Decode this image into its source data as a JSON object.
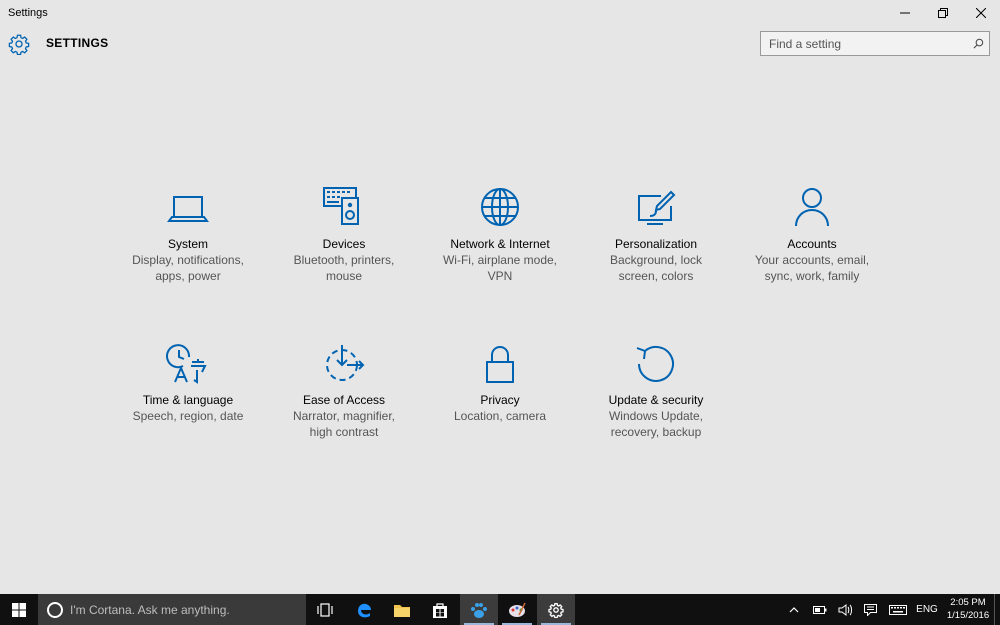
{
  "window": {
    "title": "Settings"
  },
  "header": {
    "app_title": "SETTINGS",
    "search_placeholder": "Find a setting"
  },
  "categories": [
    {
      "name": "System",
      "desc1": "Display, notifications,",
      "desc2": "apps, power",
      "icon": "laptop-icon"
    },
    {
      "name": "Devices",
      "desc1": "Bluetooth, printers,",
      "desc2": "mouse",
      "icon": "devices-icon"
    },
    {
      "name": "Network & Internet",
      "desc1": "Wi-Fi, airplane mode,",
      "desc2": "VPN",
      "icon": "globe-icon"
    },
    {
      "name": "Personalization",
      "desc1": "Background, lock",
      "desc2": "screen, colors",
      "icon": "paint-icon"
    },
    {
      "name": "Accounts",
      "desc1": "Your accounts, email,",
      "desc2": "sync, work, family",
      "icon": "person-icon"
    },
    {
      "name": "Time & language",
      "desc1": "Speech, region, date",
      "desc2": "",
      "icon": "time-language-icon"
    },
    {
      "name": "Ease of Access",
      "desc1": "Narrator, magnifier,",
      "desc2": "high contrast",
      "icon": "ease-of-access-icon"
    },
    {
      "name": "Privacy",
      "desc1": "Location, camera",
      "desc2": "",
      "icon": "lock-icon"
    },
    {
      "name": "Update & security",
      "desc1": "Windows Update,",
      "desc2": "recovery, backup",
      "icon": "update-icon"
    }
  ],
  "taskbar": {
    "cortana_text": "I'm Cortana. Ask me anything.",
    "language": "ENG",
    "time": "2:05 PM",
    "date": "1/15/2016"
  },
  "colors": {
    "accent": "#0063b1",
    "background": "#e6e6e6",
    "taskbar": "#101010"
  }
}
